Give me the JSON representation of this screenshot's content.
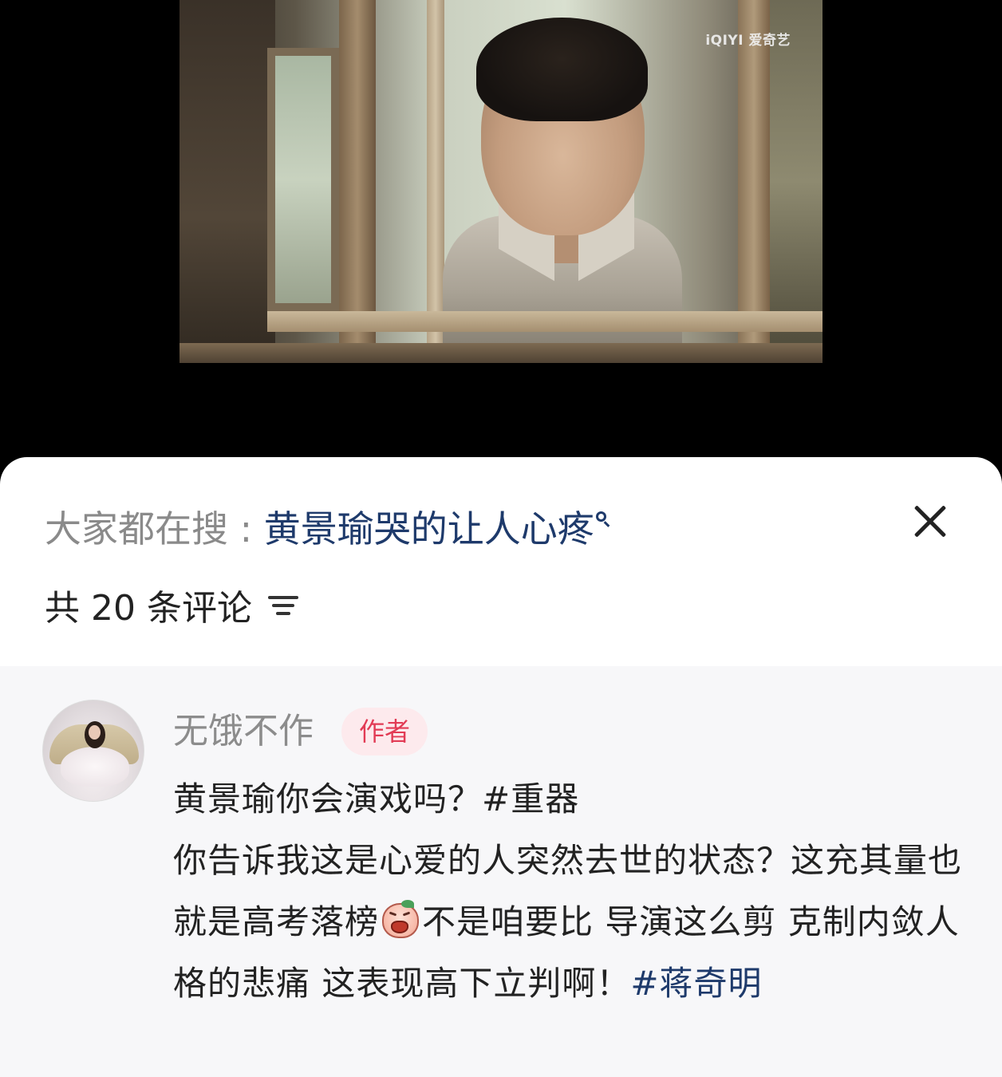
{
  "video": {
    "watermark": "iQIYI 爱奇艺"
  },
  "search_hint": {
    "prefix": "大家都在搜 : ",
    "query": "黄景瑜哭的让人心疼"
  },
  "comments_header": {
    "count_label": "共 20 条评论"
  },
  "comment": {
    "username": "无饿不作",
    "badge": "作者",
    "segments": [
      {
        "text": "黄景瑜你会演戏吗？#重器",
        "type": "text"
      },
      {
        "text": "你告诉我这是心爱的人突然去世的状态？这充其量也就是高考落榜",
        "type": "text"
      },
      {
        "text": "不是咱要比 导演这么剪 克制内敛人格的悲痛 这表现高下立判啊！",
        "type": "text"
      },
      {
        "text": "#蒋奇明",
        "type": "tag"
      }
    ],
    "emoji": "crying-peach-emoji"
  },
  "colors": {
    "accent_link": "#1e3a6b",
    "badge_text": "#e23b55",
    "badge_bg": "#fdeaed",
    "muted_text": "#8c8c8c"
  }
}
